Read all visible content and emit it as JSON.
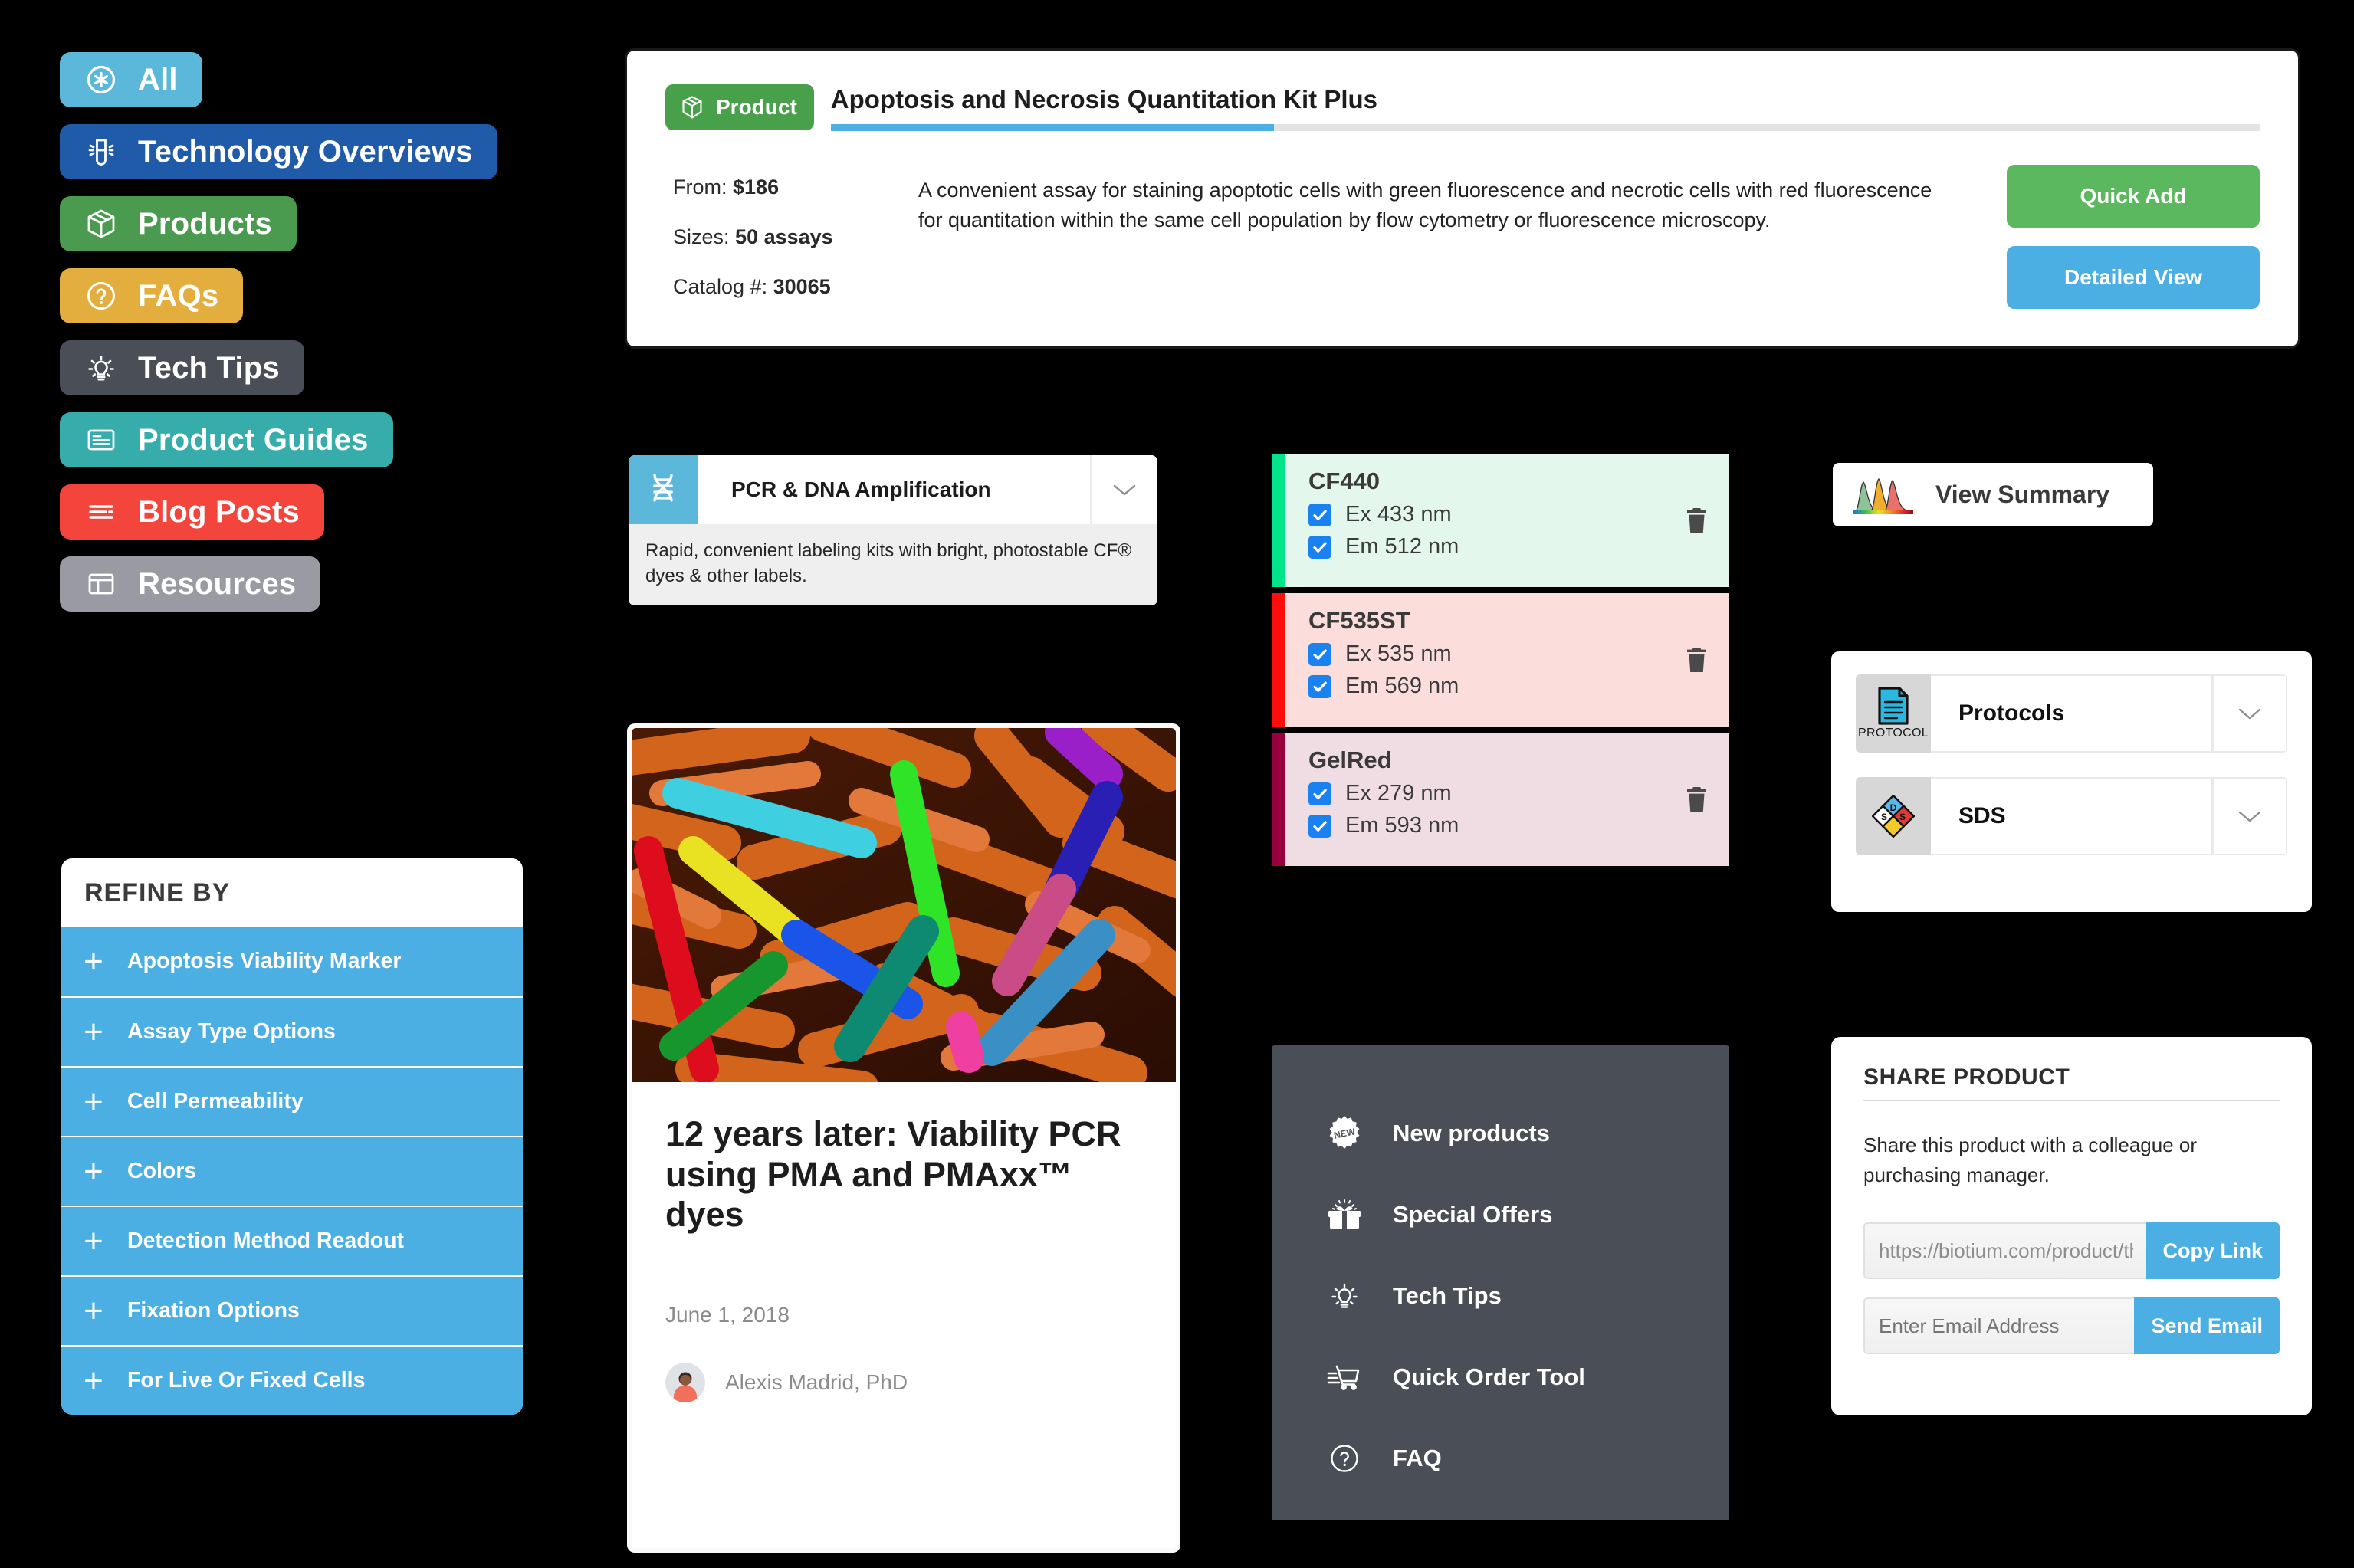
{
  "categories": [
    {
      "label": "All",
      "icon": "asterisk-circle-icon",
      "color": "#5cb8db",
      "text_size": 40
    },
    {
      "label": "Technology Overviews",
      "icon": "test-tube-icon",
      "color": "#1f5ba8",
      "text_size": 40
    },
    {
      "label": "Products",
      "icon": "box-icon",
      "color": "#4a9b4f",
      "text_size": 40
    },
    {
      "label": "FAQs",
      "icon": "question-circle-icon",
      "color": "#e3ae3e",
      "text_size": 40
    },
    {
      "label": "Tech Tips",
      "icon": "lightbulb-icon",
      "color": "#4a4f57",
      "text_size": 40
    },
    {
      "label": "Product Guides",
      "icon": "document-lines-icon",
      "color": "#36adab",
      "text_size": 40
    },
    {
      "label": "Blog Posts",
      "icon": "list-lines-icon",
      "color": "#f3453c",
      "text_size": 40
    },
    {
      "label": "Resources",
      "icon": "layout-panels-icon",
      "color": "#9a9aa3",
      "text_size": 40
    }
  ],
  "refine": {
    "title": "REFINE BY",
    "row_color": "#4bafe3",
    "items": [
      {
        "label": "Apoptosis Viability Marker"
      },
      {
        "label": "Assay Type Options"
      },
      {
        "label": "Cell Permeability"
      },
      {
        "label": "Colors"
      },
      {
        "label": "Detection Method Readout"
      },
      {
        "label": "Fixation Options"
      },
      {
        "label": "For Live Or Fixed Cells"
      }
    ]
  },
  "product_card": {
    "badge_label": "Product",
    "badge_color": "#48a04b",
    "title": "Apoptosis and Necrosis Quantitation Kit Plus",
    "progress_percent": 31,
    "progress_color": "#4bafe3",
    "meta": {
      "from_label": "From:",
      "from_value": "$186",
      "sizes_label": "Sizes:",
      "sizes_value": "50 assays",
      "catalog_label": "Catalog #:",
      "catalog_value": "30065"
    },
    "description": "A convenient assay for staining apoptotic cells with green fluorescence and necrotic cells with red fluorescence for quantitation within the same cell population by flow cytometry or fluorescence microscopy.",
    "quick_add_label": "Quick Add",
    "detailed_view_label": "Detailed View"
  },
  "pcr_card": {
    "title": "PCR & DNA Amplification",
    "icon": "dna-helix-icon",
    "icon_color": "#5cb8db",
    "description": "Rapid, convenient labeling kits with bright, photostable CF® dyes & other labels."
  },
  "dyes": [
    {
      "name": "CF440",
      "swatch": "#00e58a",
      "bg": "#e3f7ec",
      "ex_label": "Ex 433 nm",
      "em_label": "Em 512 nm",
      "ex_checked": true,
      "em_checked": true
    },
    {
      "name": "CF535ST",
      "swatch": "#ff0d0d",
      "bg": "#fbdedc",
      "ex_label": "Ex 535 nm",
      "em_label": "Em 569 nm",
      "ex_checked": true,
      "em_checked": true
    },
    {
      "name": "GelRed",
      "swatch": "#97003c",
      "bg": "#f0dde4",
      "ex_label": "Ex 279 nm",
      "em_label": "Em 593 nm",
      "ex_checked": true,
      "em_checked": true
    }
  ],
  "blog": {
    "image": "colorized-sem-bacteria-micrograph",
    "title": "12 years later: Viability PCR using PMA and PMAxx™ dyes",
    "date": "June 1, 2018",
    "author": "Alexis Madrid, PhD"
  },
  "dark_menu": {
    "background": "#4a4f57",
    "items": [
      {
        "label": "New products",
        "icon": "new-badge-icon"
      },
      {
        "label": "Special Offers",
        "icon": "gift-icon"
      },
      {
        "label": "Tech Tips",
        "icon": "lightbulb-icon"
      },
      {
        "label": "Quick Order Tool",
        "icon": "shopping-cart-icon"
      },
      {
        "label": "FAQ",
        "icon": "question-circle-icon"
      }
    ]
  },
  "view_summary": {
    "label": "View Summary",
    "icon": "spectra-peaks-icon"
  },
  "docs": {
    "items": [
      {
        "label": "Protocols",
        "icon": "protocol-document-icon",
        "icon_caption": "PROTOCOL"
      },
      {
        "label": "SDS",
        "icon": "nfpa-diamond-icon",
        "icon_caption": ""
      }
    ]
  },
  "share": {
    "title": "SHARE PRODUCT",
    "description": "Share this product with a colleague or purchasing manager.",
    "link_value": "https://biotium.com/product/th",
    "copy_link_label": "Copy Link",
    "email_placeholder": "Enter Email Address",
    "send_email_label": "Send Email",
    "button_color": "#4bafe3"
  }
}
